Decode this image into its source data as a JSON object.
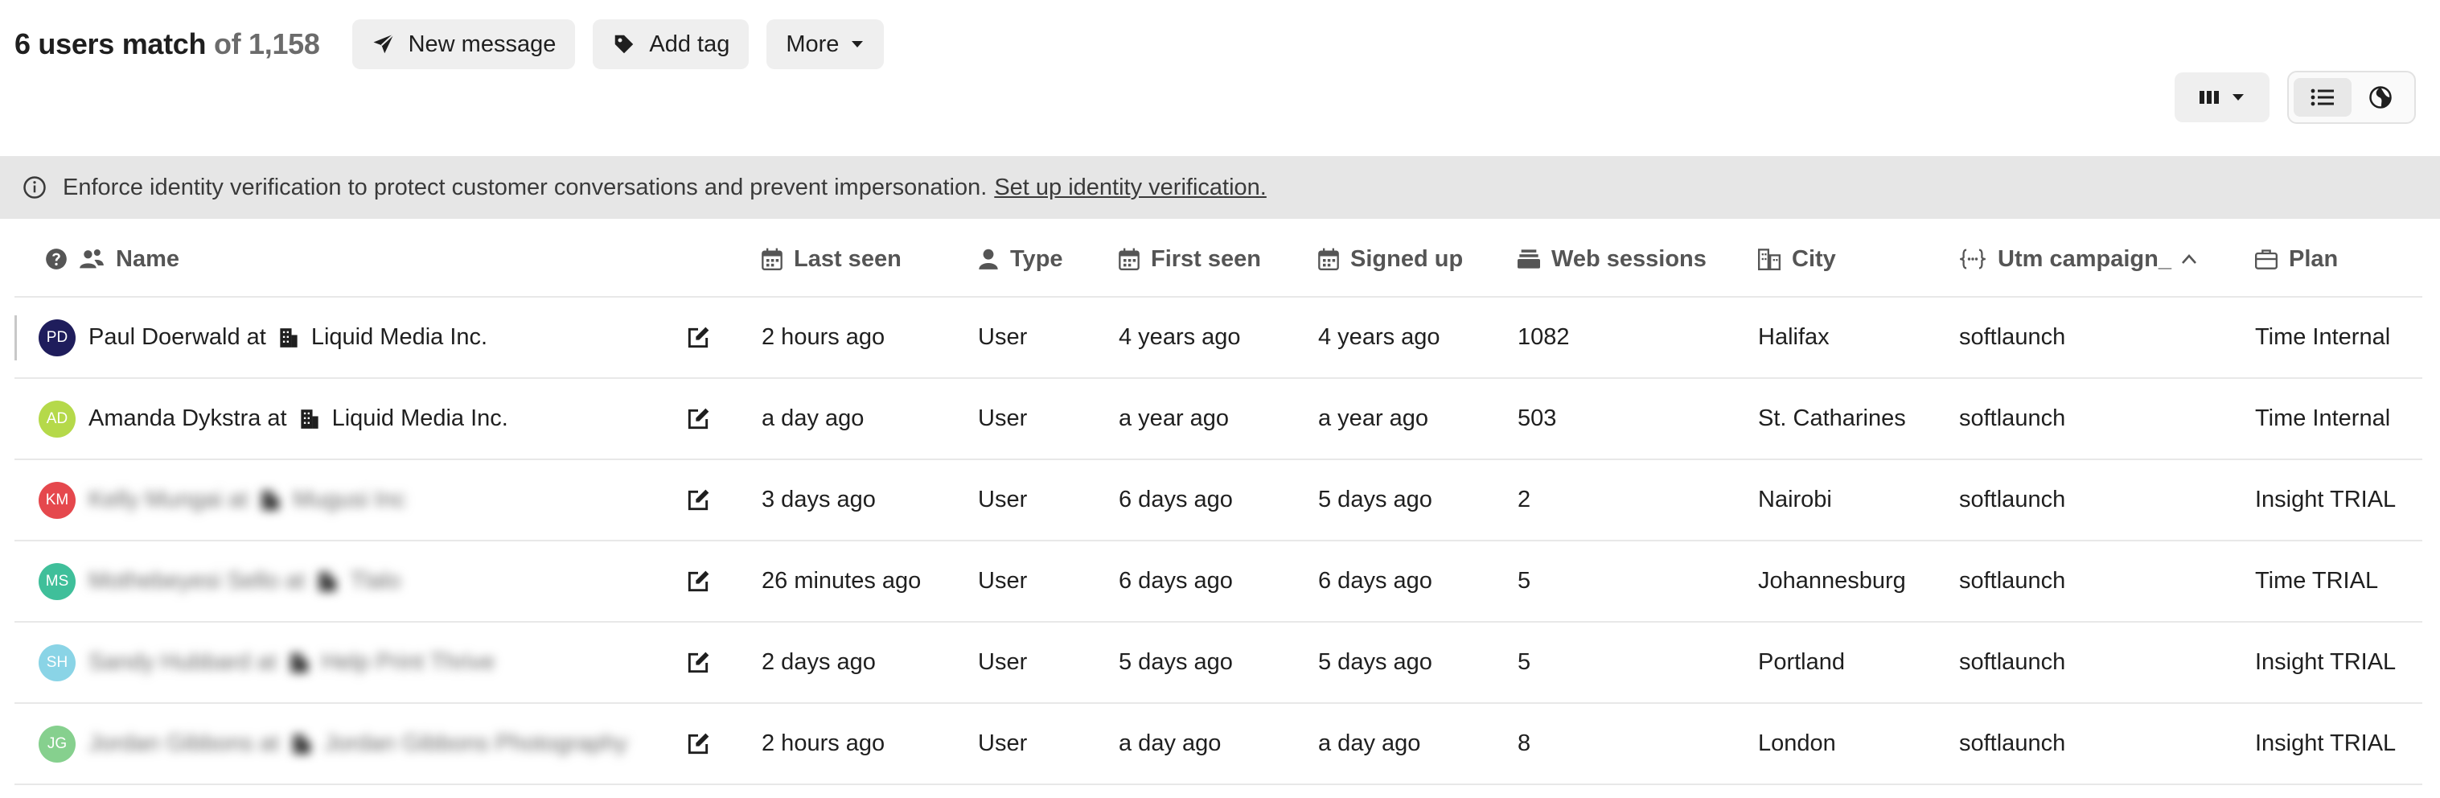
{
  "header": {
    "match_count": "6 users match",
    "of_total": "of 1,158",
    "buttons": {
      "new_message": "New message",
      "add_tag": "Add tag",
      "more": "More"
    }
  },
  "banner": {
    "text": "Enforce identity verification to protect customer conversations and prevent impersonation.",
    "link": "Set up identity verification."
  },
  "columns": {
    "name": "Name",
    "last_seen": "Last seen",
    "type": "Type",
    "first_seen": "First seen",
    "signed_up": "Signed up",
    "web_sessions": "Web sessions",
    "city": "City",
    "utm_campaign": "Utm campaign_",
    "plan": "Plan"
  },
  "rows": [
    {
      "initials": "PD",
      "avatar_color": "#1f1d5c",
      "name": "Paul Doerwald at",
      "company": "Liquid Media Inc.",
      "blurred": false,
      "last_seen": "2 hours ago",
      "type": "User",
      "first_seen": "4 years ago",
      "signed_up": "4 years ago",
      "web_sessions": "1082",
      "city": "Halifax",
      "utm_campaign": "softlaunch",
      "plan": "Time Internal"
    },
    {
      "initials": "AD",
      "avatar_color": "#b5d94a",
      "name": "Amanda Dykstra at",
      "company": "Liquid Media Inc.",
      "blurred": false,
      "last_seen": "a day ago",
      "type": "User",
      "first_seen": "a year ago",
      "signed_up": "a year ago",
      "web_sessions": "503",
      "city": "St. Catharines",
      "utm_campaign": "softlaunch",
      "plan": "Time Internal"
    },
    {
      "initials": "KM",
      "avatar_color": "#e5484d",
      "name": "Kelly Mungai at",
      "company": "Mugusi Inc",
      "blurred": true,
      "last_seen": "3 days ago",
      "type": "User",
      "first_seen": "6 days ago",
      "signed_up": "5 days ago",
      "web_sessions": "2",
      "city": "Nairobi",
      "utm_campaign": "softlaunch",
      "plan": "Insight TRIAL"
    },
    {
      "initials": "MS",
      "avatar_color": "#3fbf9a",
      "name": "Mothebeyesi Sello at",
      "company": "Tlalo",
      "blurred": true,
      "last_seen": "26 minutes ago",
      "type": "User",
      "first_seen": "6 days ago",
      "signed_up": "6 days ago",
      "web_sessions": "5",
      "city": "Johannesburg",
      "utm_campaign": "softlaunch",
      "plan": "Time TRIAL"
    },
    {
      "initials": "SH",
      "avatar_color": "#8ad4e6",
      "name": "Sandy Hubbard at",
      "company": "Help Print Thrive",
      "blurred": true,
      "last_seen": "2 days ago",
      "type": "User",
      "first_seen": "5 days ago",
      "signed_up": "5 days ago",
      "web_sessions": "5",
      "city": "Portland",
      "utm_campaign": "softlaunch",
      "plan": "Insight TRIAL"
    },
    {
      "initials": "JG",
      "avatar_color": "#86d08e",
      "name": "Jordan Gibbons at",
      "company": "Jordan Gibbons Photography",
      "blurred": true,
      "last_seen": "2 hours ago",
      "type": "User",
      "first_seen": "a day ago",
      "signed_up": "a day ago",
      "web_sessions": "8",
      "city": "London",
      "utm_campaign": "softlaunch",
      "plan": "Insight TRIAL"
    }
  ],
  "icons": {
    "new_message": "paper-plane-icon",
    "add_tag": "tag-icon",
    "more": "caret-down-icon",
    "columns": "columns-icon",
    "list_view": "list-view-icon",
    "map_view": "globe-icon",
    "info": "info-icon",
    "help": "question-circle-icon",
    "people": "people-icon",
    "calendar": "calendar-icon",
    "user": "user-icon",
    "sessions": "sessions-icon",
    "city": "buildings-icon",
    "utm": "braces-icon",
    "plan": "briefcase-icon",
    "company": "building-icon",
    "edit": "edit-icon"
  }
}
